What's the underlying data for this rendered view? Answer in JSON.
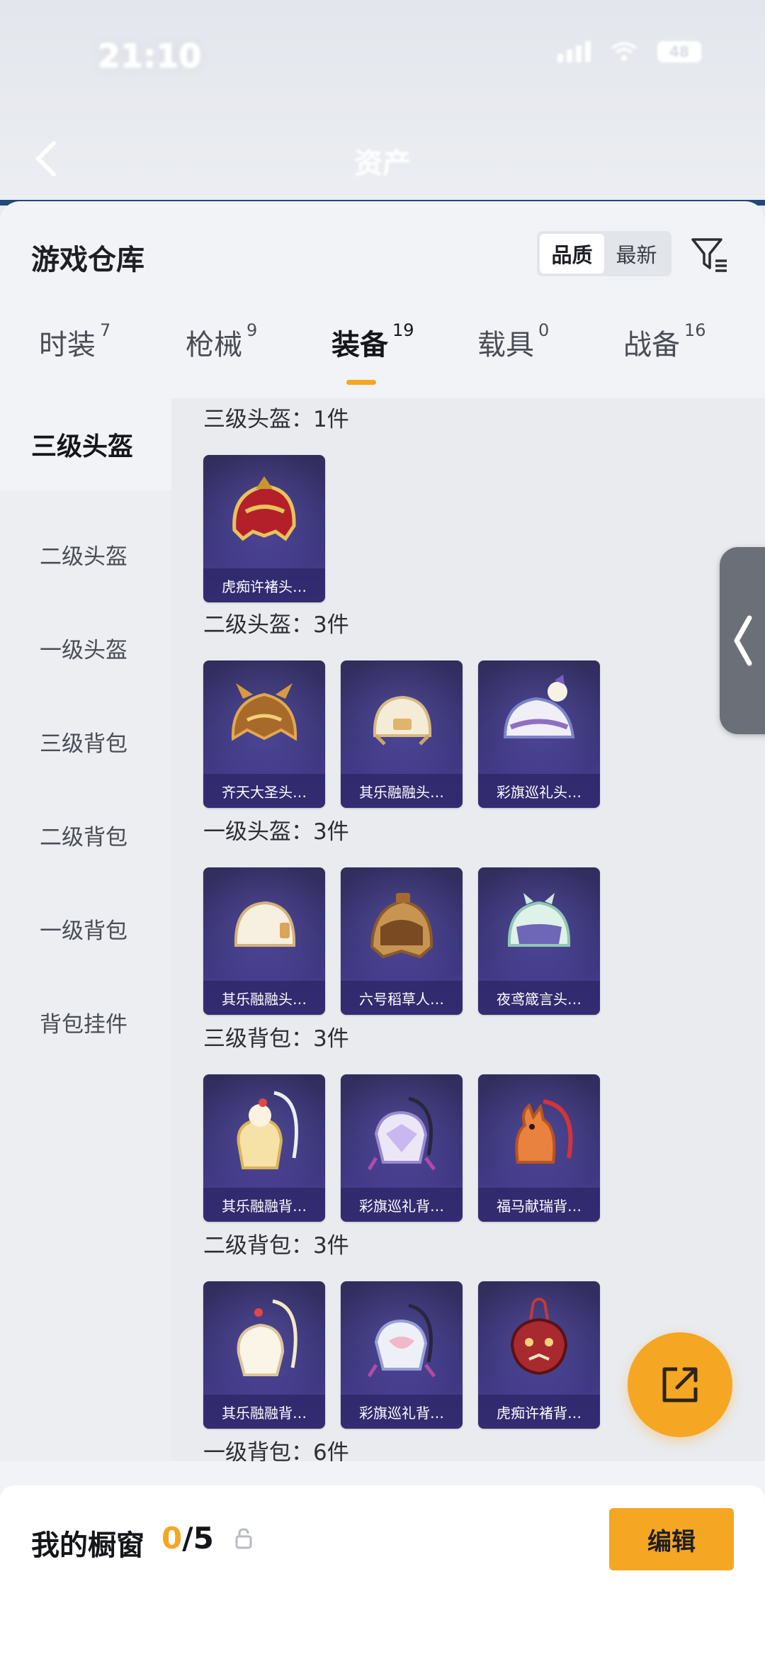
{
  "status_bar": {
    "time": "21:10",
    "extra_text": "",
    "battery": "48"
  },
  "nav": {
    "title": "资产"
  },
  "sheet": {
    "title": "游戏仓库",
    "sort_options": [
      {
        "label": "品质",
        "active": true
      },
      {
        "label": "最新",
        "active": false
      }
    ],
    "tabs": [
      {
        "label": "时装",
        "count": "7"
      },
      {
        "label": "枪械",
        "count": "9"
      },
      {
        "label": "装备",
        "count": "19",
        "active": true
      },
      {
        "label": "载具",
        "count": "0"
      },
      {
        "label": "战备",
        "count": "16"
      }
    ],
    "categories": [
      "三级头盔",
      "二级头盔",
      "一级头盔",
      "三级背包",
      "二级背包",
      "一级背包",
      "背包挂件"
    ],
    "sections": [
      {
        "title": "三级头盔：1件",
        "items": [
          {
            "name": "虎痴许褚头…",
            "icon": "red-helmet"
          }
        ]
      },
      {
        "title": "二级头盔：3件",
        "items": [
          {
            "name": "齐天大圣头…",
            "icon": "gold-helmet"
          },
          {
            "name": "其乐融融头…",
            "icon": "cream-helmet"
          },
          {
            "name": "彩旗巡礼头…",
            "icon": "parade-helmet"
          }
        ]
      },
      {
        "title": "一级头盔：3件",
        "items": [
          {
            "name": "其乐融融头…",
            "icon": "cream-helmet"
          },
          {
            "name": "六号稻草人…",
            "icon": "scarecrow-helmet"
          },
          {
            "name": "夜鸢箴言头…",
            "icon": "mint-helmet"
          }
        ]
      },
      {
        "title": "三级背包：3件",
        "items": [
          {
            "name": "其乐融融背…",
            "icon": "cake-backpack"
          },
          {
            "name": "彩旗巡礼背…",
            "icon": "parade-backpack"
          },
          {
            "name": "福马献瑞背…",
            "icon": "horse-backpack"
          }
        ]
      },
      {
        "title": "二级背包：3件",
        "items": [
          {
            "name": "其乐融融背…",
            "icon": "cake-backpack"
          },
          {
            "name": "彩旗巡礼背…",
            "icon": "parade-backpack"
          },
          {
            "name": "虎痴许褚背…",
            "icon": "tiger-backpack"
          }
        ]
      },
      {
        "title": "一级背包：6件",
        "items": []
      }
    ]
  },
  "showcase": {
    "label": "我的橱窗",
    "current": "0",
    "total": "/5"
  },
  "edit_label": "编辑",
  "colors": {
    "accent": "#f5a623",
    "card": "#3b3579"
  }
}
